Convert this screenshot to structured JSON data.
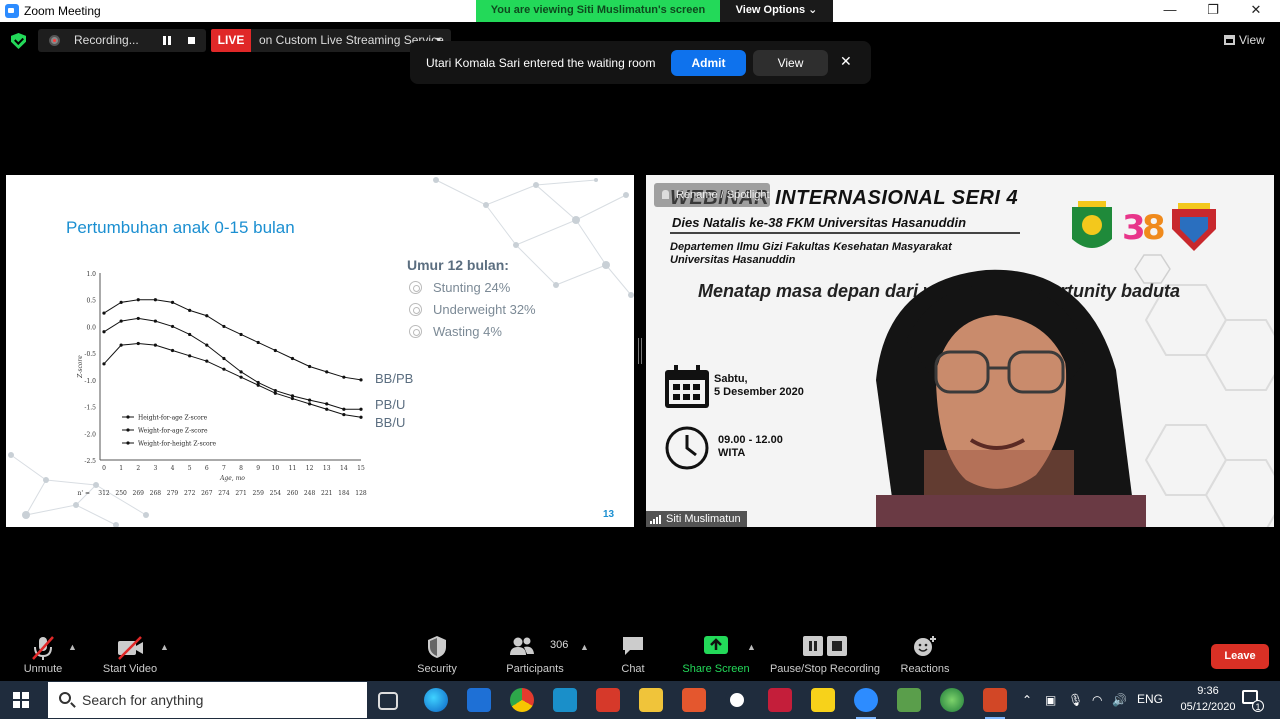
{
  "window": {
    "title": "Zoom Meeting",
    "viewing_banner": "You are viewing Siti Muslimatun's screen",
    "view_options": "View Options ⌄",
    "minimize": "—",
    "restore": "❐",
    "close": "✕"
  },
  "topbar": {
    "recording_label": "Recording...",
    "live_label": "LIVE",
    "stream_label": "on Custom Live Streaming Service",
    "view_label": "View"
  },
  "toast": {
    "message": "Utari Komala Sari entered the waiting room",
    "admit": "Admit",
    "view": "View",
    "close": "✕"
  },
  "slide": {
    "title": "Pertumbuhan anak 0-15 bulan",
    "umur_heading": "Umur 12 bulan:",
    "bullets": [
      "Stunting 24%",
      "Underweight 32%",
      "Wasting 4%"
    ],
    "side_labels": [
      "BB/PB",
      "PB/U",
      "BB/U"
    ],
    "slide_number": "13"
  },
  "chart_data": {
    "type": "line",
    "title": "",
    "xlabel": "Age, mo",
    "ylabel": "Z-score",
    "x": [
      0,
      1,
      2,
      3,
      4,
      5,
      6,
      7,
      8,
      9,
      10,
      11,
      12,
      13,
      14,
      15
    ],
    "ylim": [
      -2.5,
      1.0
    ],
    "y_ticks": [
      "1.0",
      "0.5",
      "0.0",
      "-0.5",
      "-1.0",
      "-1.5",
      "-2.0",
      "-2.5"
    ],
    "x_ticks": [
      "0",
      "1",
      "2",
      "3",
      "4",
      "5",
      "6",
      "7",
      "8",
      "9",
      "10",
      "11",
      "12",
      "13",
      "14",
      "15"
    ],
    "n_row_label": "n' =",
    "n_values": [
      "312",
      "250",
      "269",
      "268",
      "279",
      "272",
      "267",
      "274",
      "271",
      "259",
      "254",
      "260",
      "248",
      "221",
      "184",
      "128"
    ],
    "series": [
      {
        "name": "Height-for-age Z-score",
        "values": [
          -0.7,
          -0.35,
          -0.32,
          -0.35,
          -0.45,
          -0.55,
          -0.65,
          -0.8,
          -0.95,
          -1.1,
          -1.25,
          -1.35,
          -1.45,
          -1.55,
          -1.65,
          -1.7
        ]
      },
      {
        "name": "Weight-for-age Z-score",
        "values": [
          -0.1,
          0.1,
          0.15,
          0.1,
          0.0,
          -0.15,
          -0.35,
          -0.6,
          -0.85,
          -1.05,
          -1.2,
          -1.3,
          -1.38,
          -1.45,
          -1.55,
          -1.55
        ]
      },
      {
        "name": "Weight-for-height Z-score",
        "values": [
          0.25,
          0.45,
          0.5,
          0.5,
          0.45,
          0.3,
          0.2,
          0.0,
          -0.15,
          -0.3,
          -0.45,
          -0.6,
          -0.75,
          -0.85,
          -0.95,
          -1.0
        ]
      }
    ],
    "legend_position": "bottom-left"
  },
  "speaker": {
    "rename_tag": "Rename / Spotlight",
    "webinar_title": "WEBINAR  INTERNASIONAL SERI 4",
    "dies_natalis": "Dies Natalis ke-38 FKM Universitas Hasanuddin",
    "dept_1": "Departemen Ilmu Gizi Fakultas Kesehatan Masyarakat",
    "dept_2": "Universitas Hasanuddin",
    "menatap": "Menatap masa depan dari window of opportunity baduta",
    "date_1": "Sabtu,",
    "date_2": "5 Desember 2020",
    "time_1": "09.00  -  12.00",
    "time_2": "WITA",
    "name": "Siti Muslimatun"
  },
  "toolbar": {
    "unmute": "Unmute",
    "start_video": "Start Video",
    "security": "Security",
    "participants": "Participants",
    "participants_count": "306",
    "chat": "Chat",
    "share_screen": "Share Screen",
    "pause_stop_recording": "Pause/Stop Recording",
    "reactions": "Reactions",
    "leave": "Leave"
  },
  "taskbar": {
    "search_placeholder": "Search for anything",
    "lang": "ENG",
    "time": "9:36",
    "date": "05/12/2020",
    "notification_count": "1"
  },
  "colors": {
    "zoom_blue": "#0e72ed",
    "banner_green": "#23d959",
    "live_red": "#e02828",
    "leave_red": "#d93025",
    "slide_blue": "#1b8fd1"
  }
}
